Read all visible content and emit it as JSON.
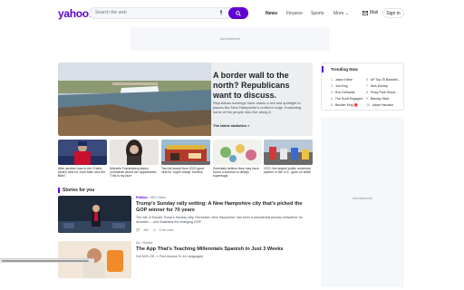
{
  "header": {
    "logo": "yahoo!",
    "search_placeholder": "Search the web",
    "nav": [
      "News",
      "Finance",
      "Sports",
      "More"
    ],
    "mail": "Mail",
    "signin": "Sign in"
  },
  "ads": {
    "label": "Advertisement"
  },
  "hero": {
    "title": "A border wall to the north? Republicans want to discuss.",
    "summary": "Republican earnings have drawn a red and spotlight to places like New Hampshire's northern edge, frustrating some of the people who live along it.",
    "link": "The latest statistics »"
  },
  "trending": {
    "title": "Trending Now",
    "items": [
      {
        "num": "1.",
        "label": "Jason Kelce"
      },
      {
        "num": "2.",
        "label": "Joe King"
      },
      {
        "num": "3.",
        "label": "Ron DeSantis"
      },
      {
        "num": "4.",
        "label": "The Scott Engaged"
      },
      {
        "num": "5.",
        "label": "Beckler King 🔴"
      },
      {
        "num": "6.",
        "label": "AP Top 25 Basketb..."
      },
      {
        "num": "7.",
        "label": "Nick Dunlap"
      },
      {
        "num": "8.",
        "label": "Pinky Park Shoot..."
      },
      {
        "num": "9.",
        "label": "Barclay Start"
      },
      {
        "num": "10.",
        "label": "Adam Harrison"
      }
    ]
  },
  "cards": [
    {
      "caption": "After another loss to the Chiefs, what's next for Josh Allen and the Bills?"
    },
    {
      "caption": "Michelle Fractenberg slams comments about her appearance: 'This is my face'"
    },
    {
      "caption": "Two bill swept from 2022 gone viral for 'super cheap' burritos"
    },
    {
      "caption": "Scientists believe they may have found a solution to deadly superbugs"
    },
    {
      "caption": "CEO, the largest public university system in the U.S., goes on strike"
    }
  ],
  "section": {
    "title": "Stories for you"
  },
  "stories": [
    {
      "publisher": "Politico",
      "category": "NBC News",
      "title": "Trump's Sunday rally setting: A New Hampshire city that's picked the GOP winner for 70 years",
      "desc": "The site of Donald Trump's Sunday rally, Rochester, New Hampshire, has been a presidential primary bellwether for decades — and illustrates the changing GOP.",
      "comments": "49K",
      "time": "6 hrs read"
    },
    {
      "publisher": "Ad",
      "category": "Babbel",
      "title": "The App That's Teaching Millennials Spanish in Just 3 Weeks",
      "desc": "Get 50% Off - 1 Free Access To 14 Languages"
    }
  ]
}
